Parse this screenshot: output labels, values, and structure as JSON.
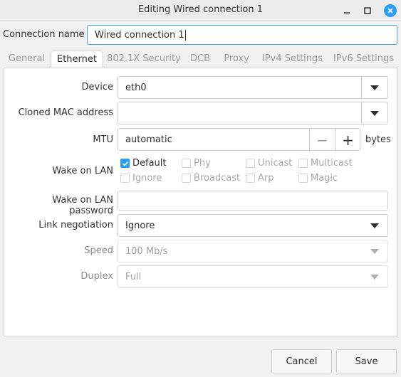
{
  "window": {
    "title": "Editing Wired connection 1"
  },
  "connection": {
    "label": "Connection name",
    "value": "Wired connection 1"
  },
  "tabs": [
    {
      "label": "General",
      "active": false
    },
    {
      "label": "Ethernet",
      "active": true
    },
    {
      "label": "802.1X Security",
      "active": false
    },
    {
      "label": "DCB",
      "active": false
    },
    {
      "label": "Proxy",
      "active": false
    },
    {
      "label": "IPv4 Settings",
      "active": false
    },
    {
      "label": "IPv6 Settings",
      "active": false
    }
  ],
  "ethernet": {
    "device": {
      "label": "Device",
      "value": "eth0"
    },
    "cloned_mac": {
      "label": "Cloned MAC address",
      "value": ""
    },
    "mtu": {
      "label": "MTU",
      "value": "automatic",
      "unit": "bytes",
      "minus": "−",
      "plus": "+"
    },
    "wake_on_lan": {
      "label": "Wake on LAN",
      "options": [
        {
          "label": "Default",
          "checked": true
        },
        {
          "label": "Phy",
          "checked": false
        },
        {
          "label": "Unicast",
          "checked": false
        },
        {
          "label": "Multicast",
          "checked": false
        },
        {
          "label": "Ignore",
          "checked": false
        },
        {
          "label": "Broadcast",
          "checked": false
        },
        {
          "label": "Arp",
          "checked": false
        },
        {
          "label": "Magic",
          "checked": false
        }
      ]
    },
    "wol_password": {
      "label": "Wake on LAN password",
      "value": ""
    },
    "link_negotiation": {
      "label": "Link negotiation",
      "value": "Ignore"
    },
    "speed": {
      "label": "Speed",
      "value": "100 Mb/s"
    },
    "duplex": {
      "label": "Duplex",
      "value": "Full"
    }
  },
  "buttons": {
    "cancel": "Cancel",
    "save": "Save"
  },
  "colors": {
    "accent": "#2a9df4"
  }
}
